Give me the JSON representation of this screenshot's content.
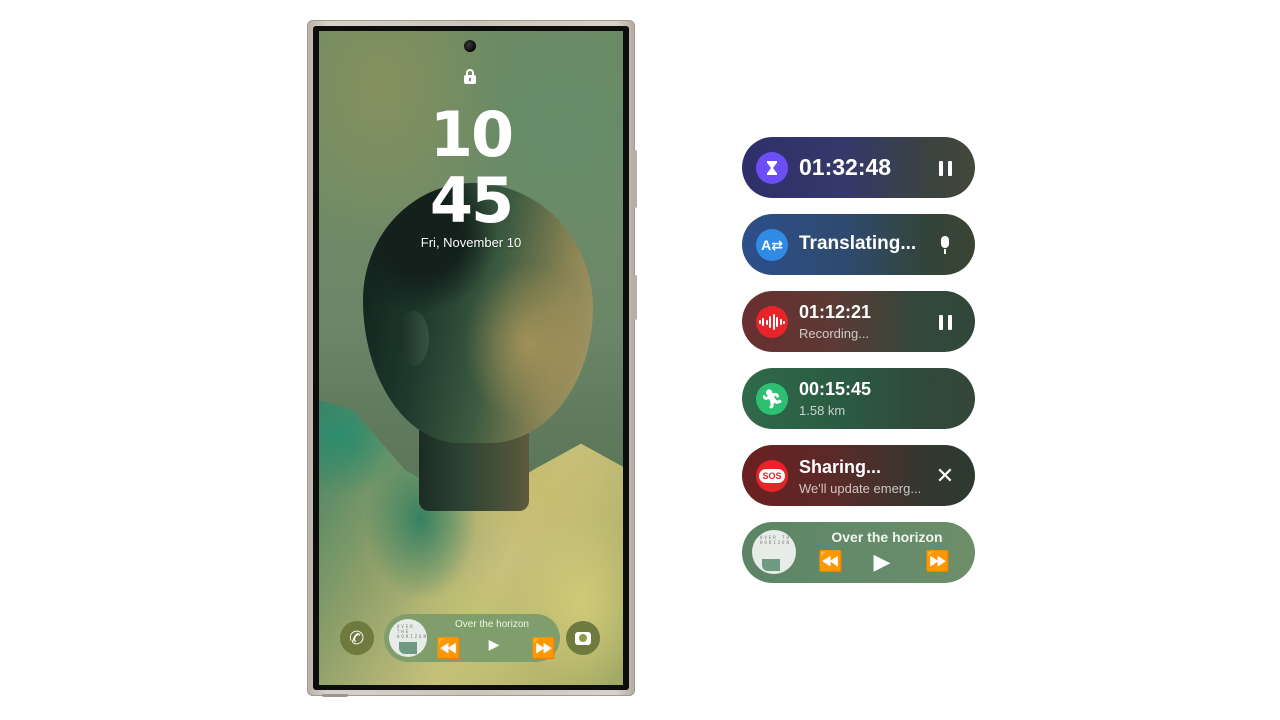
{
  "lock_screen": {
    "hour": "10",
    "minute": "45",
    "date": "Fri, November 10",
    "icons": {
      "lock": "lock-icon",
      "camera_cutout": "front-camera"
    },
    "shortcuts": {
      "left": "phone-icon",
      "right": "camera-icon"
    },
    "now_bar": {
      "track_title": "Over the horizon",
      "album_art_text": "OVER THE HORIZON",
      "controls": {
        "rewind": "⏪",
        "play": "▶",
        "fast_forward": "⏩"
      }
    }
  },
  "now_bar_pills": [
    {
      "id": "timer",
      "icon": "hourglass-icon",
      "icon_color": "#6b4ef6",
      "main": "01:32:48",
      "action": "pause-icon"
    },
    {
      "id": "translate",
      "icon": "translate-icon",
      "icon_color": "#2f8be6",
      "main": "Translating...",
      "action": "mic-icon"
    },
    {
      "id": "recording",
      "icon": "voice-recorder-icon",
      "icon_color": "#e8242a",
      "main": "01:12:21",
      "sub": "Recording...",
      "action": "pause-icon"
    },
    {
      "id": "workout",
      "icon": "running-icon",
      "icon_color": "#2fbf72",
      "main": "00:15:45",
      "sub": "1.58 km"
    },
    {
      "id": "sos",
      "icon": "sos-icon",
      "icon_color": "#e8242a",
      "icon_label": "SOS",
      "main": "Sharing...",
      "sub": "We'll update emerg...",
      "action": "close-icon",
      "action_glyph": "✕"
    },
    {
      "id": "music",
      "icon": "album-art",
      "main": "Over the horizon",
      "controls": {
        "rewind": "⏪",
        "play": "▶",
        "fast_forward": "⏩"
      }
    }
  ]
}
